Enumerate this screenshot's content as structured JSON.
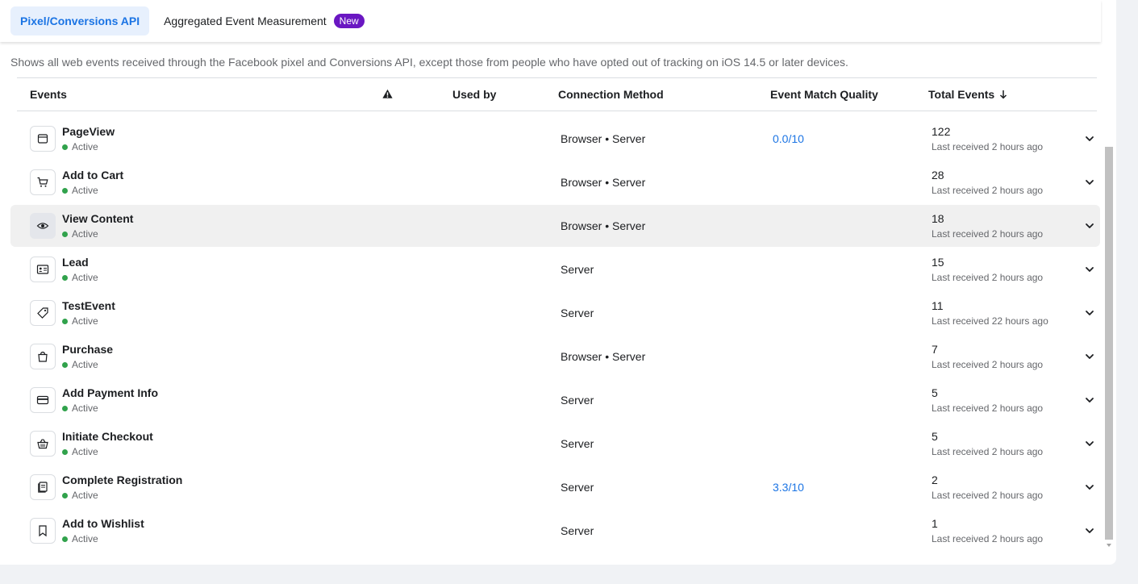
{
  "tabs": [
    {
      "label": "Pixel/Conversions API",
      "active": true
    },
    {
      "label": "Aggregated Event Measurement",
      "badge": "New"
    }
  ],
  "description": "Shows all web events received through the Facebook pixel and Conversions API, except those from people who have opted out of tracking on iOS 14.5 or later devices.",
  "columns": {
    "events": "Events",
    "warning_icon": "warning-icon",
    "used_by": "Used by",
    "connection_method": "Connection Method",
    "event_match_quality": "Event Match Quality",
    "total_events": "Total Events"
  },
  "rows": [
    {
      "name": "PageView",
      "icon": "browser-window-icon",
      "status": "Active",
      "connection": "Browser • Server",
      "emq": "0.0/10",
      "count": "122",
      "last": "Last received 2 hours ago"
    },
    {
      "name": "Add to Cart",
      "icon": "cart-icon",
      "status": "Active",
      "connection": "Browser • Server",
      "emq": "",
      "count": "28",
      "last": "Last received 2 hours ago"
    },
    {
      "name": "View Content",
      "icon": "eye-icon",
      "status": "Active",
      "connection": "Browser • Server",
      "emq": "",
      "count": "18",
      "last": "Last received 2 hours ago"
    },
    {
      "name": "Lead",
      "icon": "id-card-icon",
      "status": "Active",
      "connection": "Server",
      "emq": "",
      "count": "15",
      "last": "Last received 2 hours ago"
    },
    {
      "name": "TestEvent",
      "icon": "tag-icon",
      "status": "Active",
      "connection": "Server",
      "emq": "",
      "count": "11",
      "last": "Last received 22 hours ago"
    },
    {
      "name": "Purchase",
      "icon": "shopping-bag-icon",
      "status": "Active",
      "connection": "Browser • Server",
      "emq": "",
      "count": "7",
      "last": "Last received 2 hours ago"
    },
    {
      "name": "Add Payment Info",
      "icon": "credit-card-icon",
      "status": "Active",
      "connection": "Server",
      "emq": "",
      "count": "5",
      "last": "Last received 2 hours ago"
    },
    {
      "name": "Initiate Checkout",
      "icon": "basket-icon",
      "status": "Active",
      "connection": "Server",
      "emq": "",
      "count": "5",
      "last": "Last received 2 hours ago"
    },
    {
      "name": "Complete Registration",
      "icon": "form-icon",
      "status": "Active",
      "connection": "Server",
      "emq": "3.3/10",
      "count": "2",
      "last": "Last received 2 hours ago"
    },
    {
      "name": "Add to Wishlist",
      "icon": "bookmark-icon",
      "status": "Active",
      "connection": "Server",
      "emq": "",
      "count": "1",
      "last": "Last received 2 hours ago"
    }
  ],
  "colors": {
    "accent": "#1b74e4",
    "badge": "#6a17c2",
    "active_dot": "#31a24c",
    "hover_row": "#f0f0f0"
  }
}
